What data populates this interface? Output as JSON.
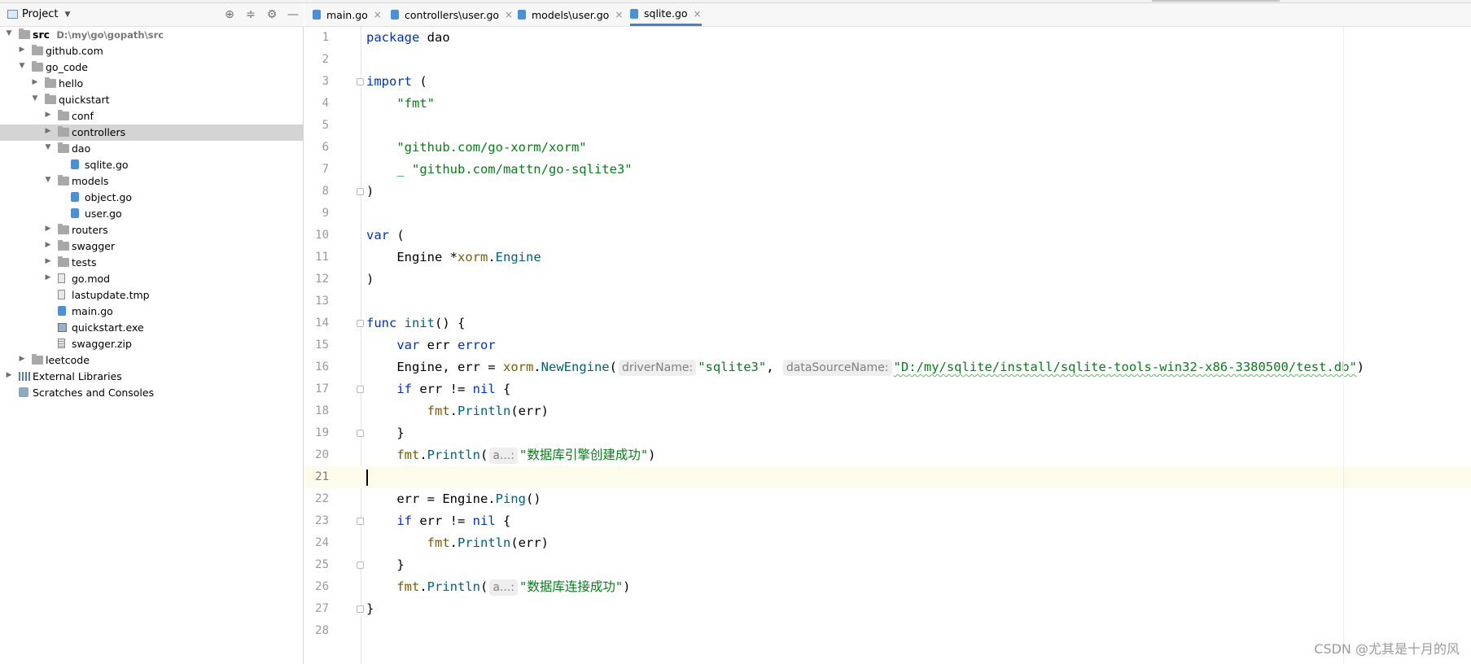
{
  "panel": {
    "title": "Project",
    "header_icons": [
      "locate-icon",
      "collapse-all-icon",
      "gear-icon",
      "minimize-icon"
    ]
  },
  "tree": [
    {
      "indent": 0,
      "arrow": "open",
      "icon": "folder",
      "label": "src",
      "bold": true,
      "path": "D:\\my\\go\\gopath\\src"
    },
    {
      "indent": 1,
      "arrow": "closed",
      "icon": "folder",
      "label": "github.com"
    },
    {
      "indent": 1,
      "arrow": "open",
      "icon": "folder",
      "label": "go_code"
    },
    {
      "indent": 2,
      "arrow": "closed",
      "icon": "folder",
      "label": "hello"
    },
    {
      "indent": 2,
      "arrow": "open",
      "icon": "folder",
      "label": "quickstart"
    },
    {
      "indent": 3,
      "arrow": "closed",
      "icon": "folder",
      "label": "conf"
    },
    {
      "indent": 3,
      "arrow": "closed",
      "icon": "folder",
      "label": "controllers",
      "selected": true
    },
    {
      "indent": 3,
      "arrow": "open",
      "icon": "folder",
      "label": "dao"
    },
    {
      "indent": 4,
      "arrow": "none",
      "icon": "go",
      "label": "sqlite.go"
    },
    {
      "indent": 3,
      "arrow": "open",
      "icon": "folder",
      "label": "models"
    },
    {
      "indent": 4,
      "arrow": "none",
      "icon": "go",
      "label": "object.go"
    },
    {
      "indent": 4,
      "arrow": "none",
      "icon": "go",
      "label": "user.go"
    },
    {
      "indent": 3,
      "arrow": "closed",
      "icon": "folder",
      "label": "routers"
    },
    {
      "indent": 3,
      "arrow": "closed",
      "icon": "folder",
      "label": "swagger"
    },
    {
      "indent": 3,
      "arrow": "closed",
      "icon": "folder",
      "label": "tests"
    },
    {
      "indent": 3,
      "arrow": "closed",
      "icon": "txt",
      "label": "go.mod"
    },
    {
      "indent": 3,
      "arrow": "none",
      "icon": "txt",
      "label": "lastupdate.tmp"
    },
    {
      "indent": 3,
      "arrow": "none",
      "icon": "go",
      "label": "main.go"
    },
    {
      "indent": 3,
      "arrow": "none",
      "icon": "exe",
      "label": "quickstart.exe"
    },
    {
      "indent": 3,
      "arrow": "none",
      "icon": "zip",
      "label": "swagger.zip"
    },
    {
      "indent": 1,
      "arrow": "closed",
      "icon": "folder",
      "label": "leetcode"
    },
    {
      "indent": 0,
      "arrow": "closed",
      "icon": "lib",
      "label": "External Libraries"
    },
    {
      "indent": 0,
      "arrow": "none",
      "icon": "scratch",
      "label": "Scratches and Consoles"
    }
  ],
  "tabs": [
    {
      "label": "main.go",
      "active": false
    },
    {
      "label": "controllers\\user.go",
      "active": false
    },
    {
      "label": "models\\user.go",
      "active": false
    },
    {
      "label": "sqlite.go",
      "active": true
    }
  ],
  "editor": {
    "current_line": 21,
    "lines": [
      [
        [
          "kw",
          "package"
        ],
        [
          "",
          "·dao"
        ]
      ],
      [],
      [
        [
          "kw",
          "import"
        ],
        [
          "",
          "·("
        ]
      ],
      [
        [
          "",
          "····"
        ],
        [
          "str",
          "\"fmt\""
        ]
      ],
      [],
      [
        [
          "",
          "····"
        ],
        [
          "str",
          "\"github.com/go-xorm/xorm\""
        ]
      ],
      [
        [
          "",
          "····"
        ],
        [
          "str",
          "_·\"github.com/mattn/go-sqlite3\""
        ]
      ],
      [
        [
          "",
          ")"
        ]
      ],
      [],
      [
        [
          "kw",
          "var"
        ],
        [
          "",
          "·("
        ]
      ],
      [
        [
          "",
          "····Engine·*"
        ],
        [
          "pkg",
          "xorm"
        ],
        [
          "",
          "."
        ],
        [
          "fn",
          "Engine"
        ]
      ],
      [
        [
          "",
          ")"
        ]
      ],
      [],
      [
        [
          "kw",
          "func"
        ],
        [
          "",
          "·"
        ],
        [
          "fn",
          "init"
        ],
        [
          "",
          "()·{"
        ]
      ],
      [
        [
          "",
          "····"
        ],
        [
          "kw",
          "var"
        ],
        [
          "",
          "·err·"
        ],
        [
          "kw",
          "error"
        ]
      ],
      [
        [
          "",
          "····Engine,·err·=·"
        ],
        [
          "pkg",
          "xorm"
        ],
        [
          "",
          "."
        ],
        [
          "fn",
          "NewEngine"
        ],
        [
          "",
          "("
        ],
        [
          "hint",
          "driverName:"
        ],
        [
          "str",
          "\"sqlite3\""
        ],
        [
          "",
          ",·"
        ],
        [
          "hint",
          "dataSourceName:"
        ],
        [
          "str",
          "\"D:/my/sqlite/install/sqlite-tools-win32-x86-3380500/test.db\""
        ],
        [
          "",
          ")"
        ]
      ],
      [
        [
          "",
          "····"
        ],
        [
          "kw",
          "if"
        ],
        [
          "",
          "·err·!=·"
        ],
        [
          "kw",
          "nil"
        ],
        [
          "",
          "·{"
        ]
      ],
      [
        [
          "",
          "········"
        ],
        [
          "pkg",
          "fmt"
        ],
        [
          "",
          "."
        ],
        [
          "fn",
          "Println"
        ],
        [
          "",
          "(err)"
        ]
      ],
      [
        [
          "",
          "····}"
        ]
      ],
      [
        [
          "",
          "····"
        ],
        [
          "pkg",
          "fmt"
        ],
        [
          "",
          "."
        ],
        [
          "fn",
          "Println"
        ],
        [
          "",
          "("
        ],
        [
          "hint",
          "a...:"
        ],
        [
          "str",
          "\"数据库引擎创建成功\""
        ],
        [
          "",
          ")"
        ]
      ],
      [],
      [
        [
          "",
          "····err·=·Engine."
        ],
        [
          "fn",
          "Ping"
        ],
        [
          "",
          "()"
        ]
      ],
      [
        [
          "",
          "····"
        ],
        [
          "kw",
          "if"
        ],
        [
          "",
          "·err·!=·"
        ],
        [
          "kw",
          "nil"
        ],
        [
          "",
          "·{"
        ]
      ],
      [
        [
          "",
          "········"
        ],
        [
          "pkg",
          "fmt"
        ],
        [
          "",
          "."
        ],
        [
          "fn",
          "Println"
        ],
        [
          "",
          "(err)"
        ]
      ],
      [
        [
          "",
          "····}"
        ]
      ],
      [
        [
          "",
          "····"
        ],
        [
          "pkg",
          "fmt"
        ],
        [
          "",
          "."
        ],
        [
          "fn",
          "Println"
        ],
        [
          "",
          "("
        ],
        [
          "hint",
          "a...:"
        ],
        [
          "str",
          "\"数据库连接成功\""
        ],
        [
          "",
          ")"
        ]
      ],
      [
        [
          "",
          "}"
        ]
      ],
      []
    ],
    "fold_lines": [
      3,
      8,
      14,
      17,
      19,
      23,
      25,
      27
    ]
  },
  "watermark": "CSDN @尤其是十月的风"
}
